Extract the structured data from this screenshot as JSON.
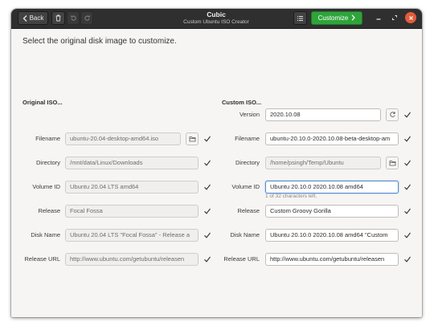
{
  "header": {
    "title": "Cubic",
    "subtitle": "Custom Ubuntu ISO Creator",
    "back_label": "Back",
    "customize_label": "Customize"
  },
  "instruction": "Select the original disk image to customize.",
  "original": {
    "heading": "Original ISO...",
    "fields": [
      {
        "label": "Filename",
        "value": "ubuntu-20.04-desktop-amd64.iso"
      },
      {
        "label": "Directory",
        "value": "/mnt/data/Linux/Downloads"
      },
      {
        "label": "Volume ID",
        "value": "Ubuntu 20.04 LTS amd64"
      },
      {
        "label": "Release",
        "value": "Focal Fossa"
      },
      {
        "label": "Disk Name",
        "value": "Ubuntu 20.04 LTS \"Focal Fossa\" - Release a"
      },
      {
        "label": "Release URL",
        "value": "http://www.ubuntu.com/getubuntu/releasen"
      }
    ]
  },
  "custom": {
    "heading": "Custom ISO...",
    "fields": [
      {
        "label": "Version",
        "value": "2020.10.08"
      },
      {
        "label": "Filename",
        "value": "ubuntu-20.10.0-2020.10.08-beta-desktop-am"
      },
      {
        "label": "Directory",
        "value": "/home/psingh/Temp/Ubuntu"
      },
      {
        "label": "Volume ID",
        "value": "Ubuntu 20.10.0 2020.10.08 amd64"
      },
      {
        "label": "Release",
        "value": "Custom Groovy Gorilla"
      },
      {
        "label": "Disk Name",
        "value": "Ubuntu 20.10.0 2020.10.08 amd64 \"Custom"
      },
      {
        "label": "Release URL",
        "value": "http://www.ubuntu.com/getubuntu/releasen"
      }
    ],
    "volume_id_hint": "1 of 32 characters left."
  },
  "colors": {
    "headerbar": "#2f2f2f",
    "customize_button": "#2fa43a",
    "close_button": "#e35b3c",
    "check": "#2e2e2e",
    "focus_border": "#5a8fd0"
  },
  "icons": [
    "chevron-left-icon",
    "trash-icon",
    "undo-icon",
    "redo-icon",
    "list-icon",
    "chevron-right-icon",
    "minimize-icon",
    "maximize-icon",
    "close-icon",
    "folder-icon",
    "refresh-icon",
    "checkmark-icon"
  ]
}
